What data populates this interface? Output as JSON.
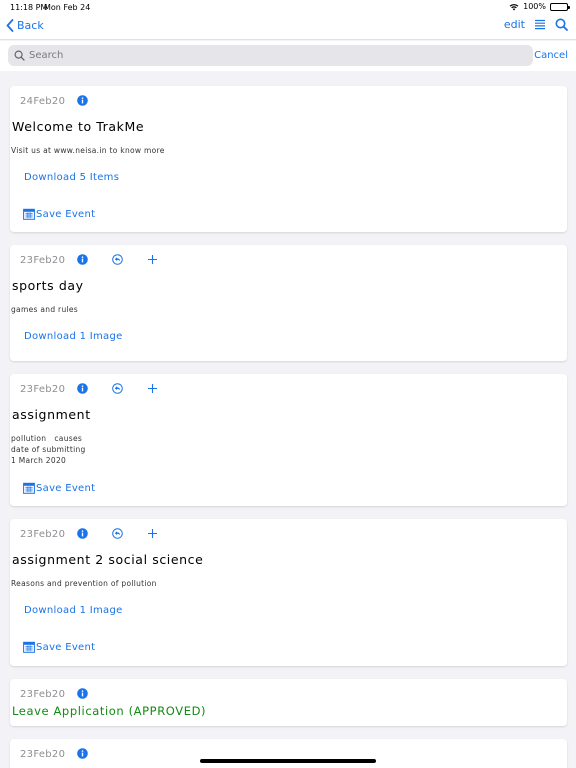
{
  "status": {
    "time": "11:18 PM",
    "date": "Mon Feb 24",
    "battery": "100%"
  },
  "nav": {
    "back_label": "Back",
    "edit_label": "edit"
  },
  "search": {
    "placeholder": "Search",
    "cancel_label": "Cancel"
  },
  "colors": {
    "accent": "#1a73e8",
    "approved": "#138a13",
    "background": "#f2f2f7"
  },
  "cards": [
    {
      "date": "24Feb20",
      "title": "Welcome to TrakMe",
      "body": "Visit us at www.neisa.in to know more",
      "download": "Download 5 Items",
      "save": "Save Event"
    },
    {
      "date": "23Feb20",
      "title": "sports day",
      "body": "games and rules",
      "download": "Download 1 Image"
    },
    {
      "date": "23Feb20",
      "title": "assignment",
      "body": "pollution   causes\ndate of submitting\n1 March 2020",
      "save": "Save Event"
    },
    {
      "date": "23Feb20",
      "title": "assignment 2 social science",
      "body": "Reasons and prevention of pollution",
      "download": "Download 1 Image",
      "save": "Save Event"
    },
    {
      "date": "23Feb20",
      "title": "Leave Application (APPROVED)"
    },
    {
      "date": "23Feb20"
    }
  ]
}
